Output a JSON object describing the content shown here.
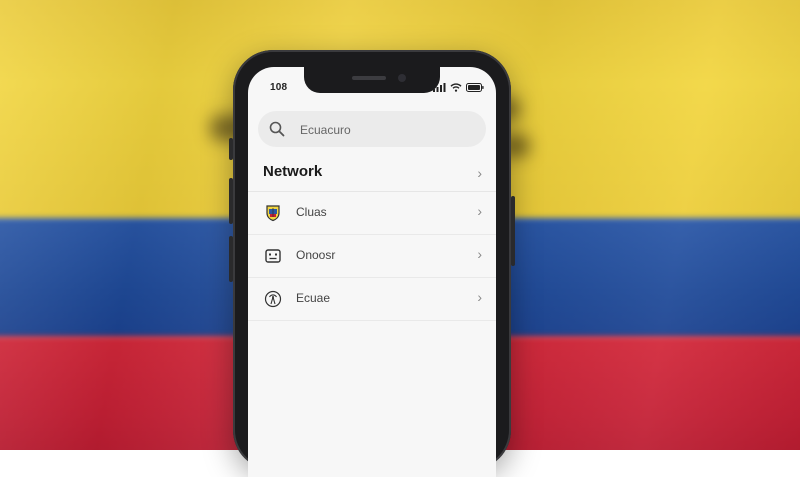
{
  "status_bar": {
    "time": "108",
    "icons": [
      "cellular-signal-icon",
      "wifi-icon",
      "battery-icon"
    ]
  },
  "search": {
    "placeholder": "Ecuacuro",
    "icon": "search-icon"
  },
  "section": {
    "title": "Network",
    "chevron": "›"
  },
  "rows": [
    {
      "label": "Cluas",
      "icon": "shield-emblem-icon",
      "chevron": "›"
    },
    {
      "label": "Onoosr",
      "icon": "face-card-icon",
      "chevron": "›"
    },
    {
      "label": "Ecuae",
      "icon": "signal-tower-icon",
      "chevron": "›"
    }
  ],
  "colors": {
    "flag_yellow": "#f2d640",
    "flag_blue": "#1f4a99",
    "flag_red": "#c52035",
    "screen_bg": "#f7f7f7",
    "search_bg": "#ebebeb",
    "phone_frame": "#1b1b1d"
  }
}
